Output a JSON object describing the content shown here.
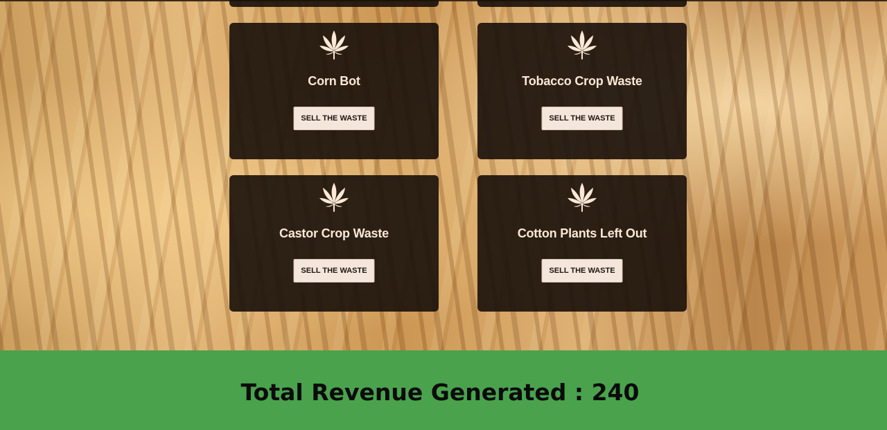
{
  "cards": [
    {
      "title": "Corn Bot",
      "button_label": "SELL THE WASTE",
      "icon": "cannabis-leaf-icon"
    },
    {
      "title": "Tobacco Crop Waste",
      "button_label": "SELL THE WASTE",
      "icon": "cannabis-leaf-icon"
    },
    {
      "title": "Castor Crop Waste",
      "button_label": "SELL THE WASTE",
      "icon": "cannabis-leaf-icon"
    },
    {
      "title": "Cotton Plants Left Out",
      "button_label": "SELL THE WASTE",
      "icon": "cannabis-leaf-icon"
    }
  ],
  "footer": {
    "revenue_label": "Total Revenue Generated : 240"
  },
  "colors": {
    "card_bg": "#18100a",
    "card_title": "#fbe8d6",
    "button_bg": "#f4e6da",
    "footer_bg": "#4aa24d"
  }
}
